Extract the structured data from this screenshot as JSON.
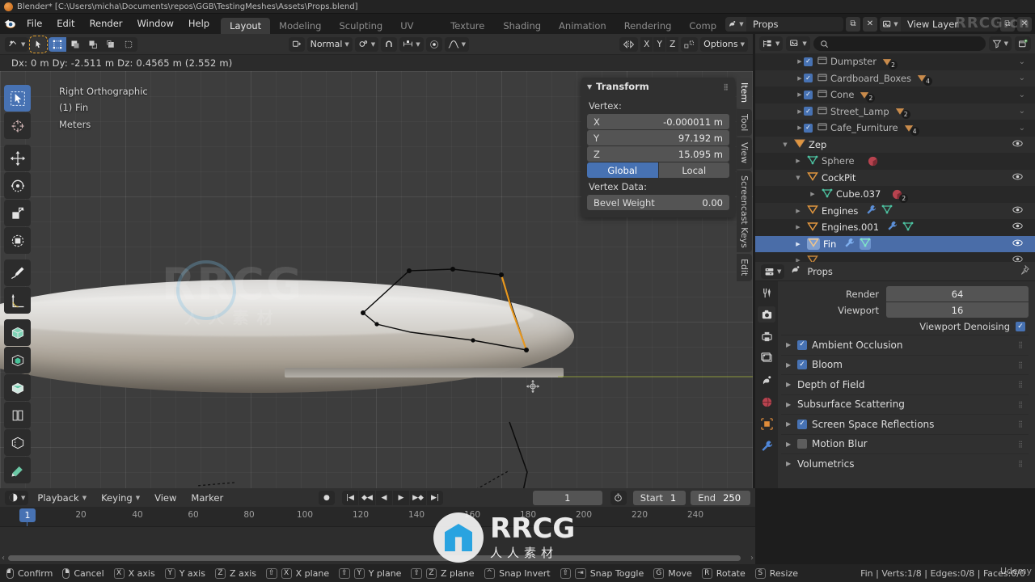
{
  "window": {
    "title": "Blender* [C:\\Users\\micha\\Documents\\repos\\GGB\\TestingMeshes\\Assets\\Props.blend]",
    "app_icon": "blender-logo-icon"
  },
  "topbar": {
    "menus": [
      "File",
      "Edit",
      "Render",
      "Window",
      "Help"
    ],
    "workspace_tabs": [
      {
        "label": "Layout",
        "active": true
      },
      {
        "label": "Modeling",
        "active": false
      },
      {
        "label": "Sculpting",
        "active": false
      },
      {
        "label": "UV Editing",
        "active": false
      },
      {
        "label": "Texture Paint",
        "active": false
      },
      {
        "label": "Shading",
        "active": false
      },
      {
        "label": "Animation",
        "active": false
      },
      {
        "label": "Rendering",
        "active": false
      },
      {
        "label": "Comp",
        "active": false
      }
    ],
    "scene_name": "Props",
    "view_layer_name": "View Layer",
    "scene_icon": "scene-icon",
    "viewlayer_icon": "view-layer-icon",
    "new_button": "new-copy-icon",
    "unlink_button": "x-icon"
  },
  "viewport_header": {
    "editor_type_icon": "editor-type-icon",
    "select_tool_icon": "cursor-select-icon",
    "mesh_select_modes": [
      {
        "name": "vertex-select-mode",
        "active": true
      },
      {
        "name": "edge-select-mode",
        "active": false
      },
      {
        "name": "face-select-mode",
        "active": false
      }
    ],
    "extra_mode_icons": [
      "mode-extra-1",
      "mode-extra-2"
    ],
    "orientation_label": "Normal",
    "orientation_icon": "orientation-icon",
    "pivot_icon": "pivot-point-icon",
    "snap_icon": "snap-magnet-icon",
    "snap_dropdown_icon": "snap-target-icon",
    "proportional_icon": "proportional-edit-icon",
    "falloff_icon": "proportional-falloff-icon",
    "mirror_icon": "mirror-icon",
    "axis_buttons": [
      "X",
      "Y",
      "Z"
    ],
    "autom_icon": "auto-merge-icon",
    "options_label": "Options"
  },
  "info_strip": {
    "text": "Dx: 0 m   Dy: -2.511 m  Dz: 0.4565 m (2.552 m)"
  },
  "viewport": {
    "view_name": "Right Orthographic",
    "collection_object": "(1) Fin",
    "units": "Meters",
    "toolbar_tools": [
      {
        "name": "tweak-select-tool",
        "active": true
      },
      {
        "name": "cursor-tool",
        "active": false
      },
      {
        "name": "move-tool",
        "active": false
      },
      {
        "name": "rotate-tool",
        "active": false
      },
      {
        "name": "scale-tool",
        "active": false
      },
      {
        "name": "transform-tool",
        "active": false
      },
      {
        "name": "annotate-tool",
        "active": false
      },
      {
        "name": "measure-tool",
        "active": false
      },
      {
        "name": "add-cube-tool",
        "active": false
      },
      {
        "name": "extrude-region-tool",
        "active": false
      },
      {
        "name": "inset-faces-tool",
        "active": false
      },
      {
        "name": "bevel-tool",
        "active": false
      },
      {
        "name": "loop-cut-tool",
        "active": false
      },
      {
        "name": "knife-tool",
        "active": false
      }
    ]
  },
  "n_panel": {
    "tabs": [
      {
        "label": "Item",
        "active": true
      },
      {
        "label": "Tool",
        "active": false
      },
      {
        "label": "View",
        "active": false
      },
      {
        "label": "Screencast Keys",
        "active": false
      },
      {
        "label": "Edit",
        "active": false
      }
    ],
    "panel_title": "Transform",
    "vertex_label": "Vertex:",
    "fields": [
      {
        "key": "X",
        "value": "-0.000011 m"
      },
      {
        "key": "Y",
        "value": "97.192 m"
      },
      {
        "key": "Z",
        "value": "15.095 m"
      }
    ],
    "space_buttons": [
      {
        "label": "Global",
        "active": true
      },
      {
        "label": "Local",
        "active": false
      }
    ],
    "vertex_data_label": "Vertex Data:",
    "bevel_weight_label": "Bevel Weight",
    "bevel_weight_value": "0.00"
  },
  "outliner": {
    "display_mode_icon": "outliner-display-mode-icon",
    "filter_id_icon": "outliner-id-type-icon",
    "search_placeholder": "",
    "filter_icon": "funnel-filter-icon",
    "new_collection_icon": "new-collection-icon",
    "rows": [
      {
        "name": "Dumpster",
        "indent": 1,
        "type": "collection",
        "checkbox": true,
        "badge": "mesh-data",
        "badge_count": "2",
        "chevron": true,
        "selected": false
      },
      {
        "name": "Cardboard_Boxes",
        "indent": 1,
        "type": "collection",
        "checkbox": true,
        "badge": "mesh-data",
        "badge_count": "4",
        "chevron": true,
        "selected": false
      },
      {
        "name": "Cone",
        "indent": 1,
        "type": "collection",
        "checkbox": true,
        "badge": "mesh-data",
        "badge_count": "2",
        "chevron": true,
        "selected": false
      },
      {
        "name": "Street_Lamp",
        "indent": 1,
        "type": "collection",
        "checkbox": true,
        "badge": "mesh-data",
        "badge_count": "2",
        "chevron": true,
        "selected": false
      },
      {
        "name": "Cafe_Furniture",
        "indent": 1,
        "type": "collection",
        "checkbox": true,
        "badge": "mesh-data",
        "badge_count": "4",
        "chevron": true,
        "selected": false
      },
      {
        "name": "Zep",
        "indent": 1,
        "type": "object",
        "checkbox": false,
        "badge": "",
        "badge_count": "",
        "eye": true,
        "selected": false
      },
      {
        "name": "Sphere",
        "indent": 2,
        "type": "mesh",
        "checkbox": false,
        "badge": "material",
        "badge_count": "",
        "eye": false,
        "selected": false
      },
      {
        "name": "CockPit",
        "indent": 2,
        "type": "object",
        "checkbox": false,
        "badge": "",
        "badge_count": "",
        "eye": true,
        "selected": false
      },
      {
        "name": "Cube.037",
        "indent": 3,
        "type": "mesh",
        "checkbox": false,
        "badge": "material",
        "badge_count": "2",
        "eye": false,
        "selected": false
      },
      {
        "name": "Engines",
        "indent": 2,
        "type": "object",
        "checkbox": false,
        "badge": "modifier",
        "badge_count": "",
        "eye": true,
        "selected": false
      },
      {
        "name": "Engines.001",
        "indent": 2,
        "type": "object",
        "checkbox": false,
        "badge": "modifier",
        "badge_count": "",
        "eye": true,
        "selected": false
      },
      {
        "name": "Fin",
        "indent": 2,
        "type": "object",
        "checkbox": false,
        "badge": "modifier",
        "badge_count": "",
        "eye": true,
        "selected": true
      }
    ]
  },
  "properties": {
    "editor_icon": "properties-editor-icon",
    "breadcrumb": "Props",
    "breadcrumb_icon": "render-properties-icon",
    "pin_icon": "pin-icon",
    "tabs": [
      {
        "name": "tool-properties-tab",
        "active": false
      },
      {
        "name": "render-properties-tab",
        "active": true
      },
      {
        "name": "output-properties-tab",
        "active": false
      },
      {
        "name": "view-layer-properties-tab",
        "active": false
      },
      {
        "name": "scene-properties-tab",
        "active": false
      },
      {
        "name": "world-properties-tab",
        "active": false
      },
      {
        "name": "object-properties-tab",
        "active": false
      },
      {
        "name": "modifier-properties-tab",
        "active": false
      }
    ],
    "sampling": [
      {
        "label": "Render",
        "value": "64"
      },
      {
        "label": "Viewport",
        "value": "16"
      }
    ],
    "viewport_denoising_label": "Viewport Denoising",
    "viewport_denoising_checked": true,
    "panels": [
      {
        "label": "Ambient Occlusion",
        "checkbox": true,
        "checked": true
      },
      {
        "label": "Bloom",
        "checkbox": true,
        "checked": true
      },
      {
        "label": "Depth of Field",
        "checkbox": false,
        "checked": false
      },
      {
        "label": "Subsurface Scattering",
        "checkbox": false,
        "checked": false
      },
      {
        "label": "Screen Space Reflections",
        "checkbox": true,
        "checked": true
      },
      {
        "label": "Motion Blur",
        "checkbox": true,
        "checked": false
      },
      {
        "label": "Volumetrics",
        "checkbox": false,
        "checked": false
      }
    ]
  },
  "timeline": {
    "editor_icon": "timeline-editor-icon",
    "menus": [
      "Playback",
      "Keying",
      "View",
      "Marker"
    ],
    "transport_icons": [
      "record-icon",
      "jump-start-icon",
      "prev-keyframe-icon",
      "play-reverse-icon",
      "play-icon",
      "next-keyframe-icon",
      "jump-end-icon"
    ],
    "current_frame": "1",
    "use_preview_range_icon": "stopwatch-icon",
    "start_label": "Start",
    "start_value": "1",
    "end_label": "End",
    "end_value": "250",
    "ticks": [
      "20",
      "40",
      "60",
      "80",
      "100",
      "120",
      "140",
      "160",
      "180",
      "200",
      "220",
      "240"
    ],
    "playhead_frame": "1"
  },
  "statusbar": {
    "items": [
      {
        "keys": [
          "mouse-left"
        ],
        "label": "Confirm"
      },
      {
        "keys": [
          "mouse-right"
        ],
        "label": "Cancel"
      },
      {
        "keys": [
          "X"
        ],
        "label": "X axis"
      },
      {
        "keys": [
          "Y"
        ],
        "label": "Y axis"
      },
      {
        "keys": [
          "Z"
        ],
        "label": "Z axis"
      },
      {
        "keys": [
          "Shift",
          "X"
        ],
        "label": "X plane"
      },
      {
        "keys": [
          "Shift",
          "Y"
        ],
        "label": "Y plane"
      },
      {
        "keys": [
          "Shift",
          "Z"
        ],
        "label": "Z plane"
      },
      {
        "keys": [
          "Ctrl"
        ],
        "label": "Snap Invert"
      },
      {
        "keys": [
          "Shift",
          "Tab"
        ],
        "label": "Snap Toggle"
      },
      {
        "keys": [
          "G"
        ],
        "label": "Move"
      },
      {
        "keys": [
          "R"
        ],
        "label": "Rotate"
      },
      {
        "keys": [
          "S"
        ],
        "label": "Resize"
      }
    ],
    "stats": "Fin | Verts:1/8 | Edges:0/8 | Faces:0/0"
  },
  "watermarks": {
    "top_right": "RRCG.cn",
    "viewport": "RRCG",
    "viewport_sub": "人人素材",
    "bottom_big": "RRCG",
    "bottom_sub": "人人素材",
    "udemy": "Udemy"
  },
  "colors": {
    "accent_blue": "#4772b3",
    "selection_blue": "#4a6da8",
    "collection_orange": "#d08a3e",
    "mesh_green": "#4cc1a0",
    "panel_bg": "#303030",
    "editor_bg": "#282828",
    "viewport_bg": "#3d3d3d"
  }
}
